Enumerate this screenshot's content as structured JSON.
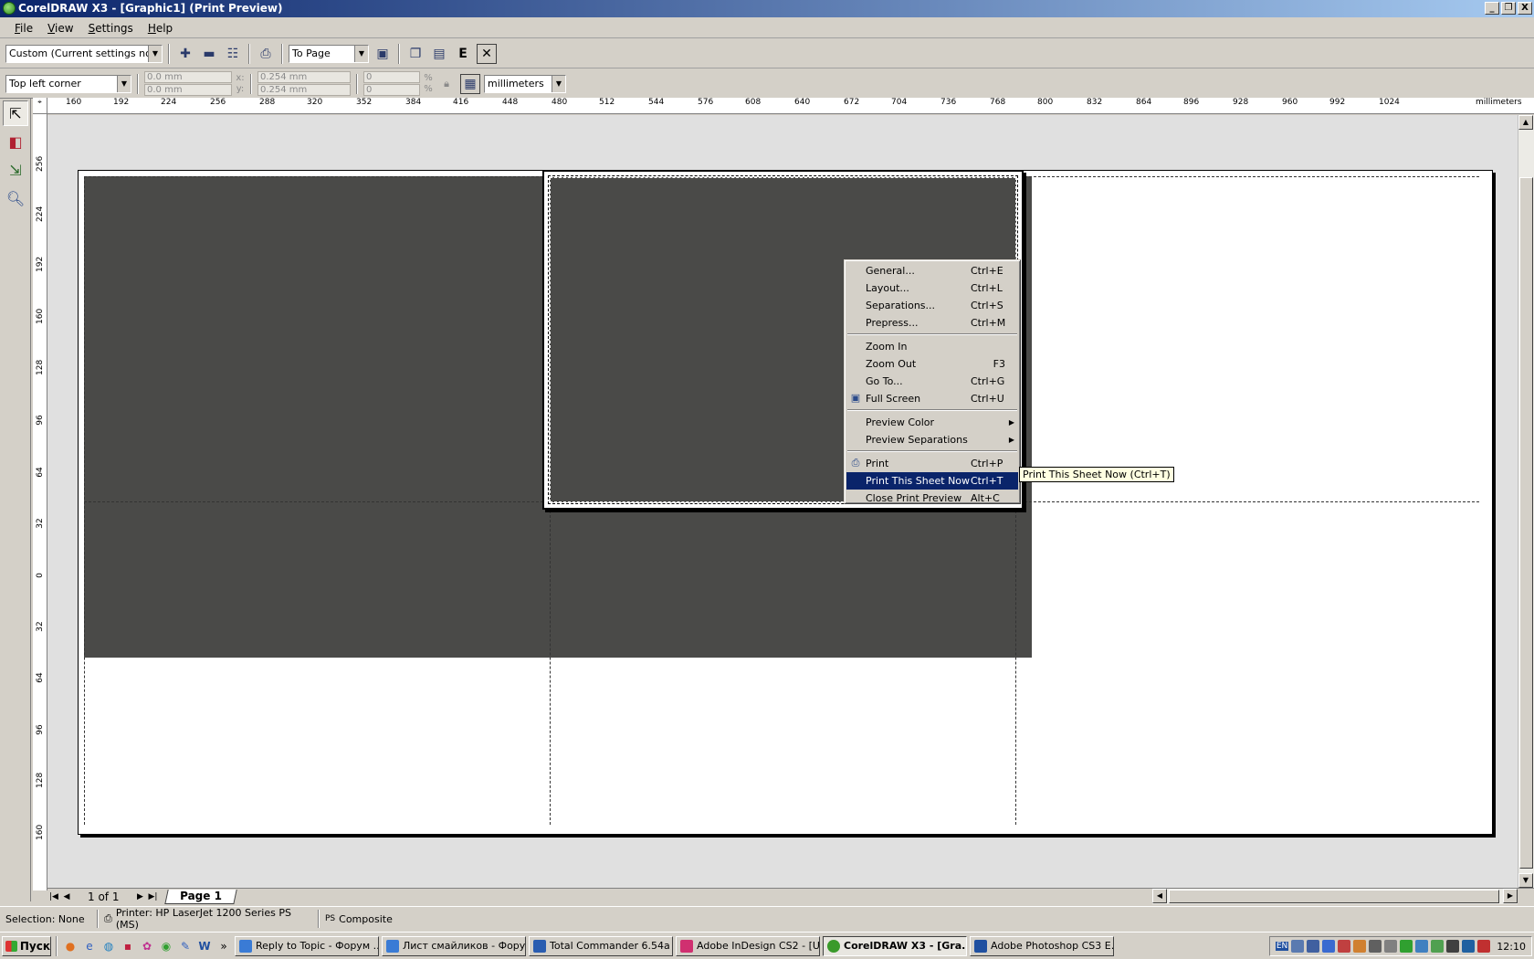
{
  "window": {
    "title": "CorelDRAW X3 - [Graphic1] (Print Preview)",
    "controls": [
      "_",
      "❐",
      "X"
    ]
  },
  "menu": [
    "File",
    "View",
    "Settings",
    "Help"
  ],
  "toolbar1": {
    "print_style": "Custom (Current settings not s...",
    "zoom": "To Page",
    "icons": [
      "zoom-in-icon",
      "zoom-out-icon",
      "print-options-icon",
      "print-icon",
      "full-screen-icon",
      "print-this-sheet-icon",
      "separations-icon",
      "enable-icon",
      "close-icon"
    ]
  },
  "toolbar2": {
    "position": "Top left corner",
    "x_value": "0.0 mm",
    "y_value": "0.0 mm",
    "x_label": "x:",
    "y_label": "y:",
    "width_value": "0.254 mm",
    "height_value": "0.254 mm",
    "scale_x": "0",
    "scale_y": "0",
    "pct_x": "%",
    "pct_y": "%",
    "units": "millimeters"
  },
  "ruler_top": [
    "160",
    "192",
    "224",
    "256",
    "288",
    "320",
    "352",
    "384",
    "416",
    "448",
    "480",
    "512",
    "544",
    "576",
    "608",
    "640",
    "672",
    "704",
    "736",
    "768",
    "800",
    "832",
    "864",
    "896",
    "928",
    "960",
    "992",
    "1024"
  ],
  "ruler_units": "millimeters",
  "ruler_left": [
    "256",
    "224",
    "192",
    "160",
    "128",
    "96",
    "64",
    "32",
    "0",
    "32",
    "64",
    "96",
    "128",
    "160"
  ],
  "context_menu": [
    {
      "label": "General...",
      "shortcut": "Ctrl+E"
    },
    {
      "label": "Layout...",
      "shortcut": "Ctrl+L"
    },
    {
      "label": "Separations...",
      "shortcut": "Ctrl+S"
    },
    {
      "label": "Prepress...",
      "shortcut": "Ctrl+M"
    },
    {
      "label": "Zoom In",
      "shortcut": ""
    },
    {
      "label": "Zoom Out",
      "shortcut": "F3"
    },
    {
      "label": "Go To...",
      "shortcut": "Ctrl+G"
    },
    {
      "label": "Full Screen",
      "shortcut": "Ctrl+U"
    },
    {
      "label": "Preview Color",
      "shortcut": ""
    },
    {
      "label": "Preview Separations",
      "shortcut": ""
    },
    {
      "label": "Print",
      "shortcut": "Ctrl+P"
    },
    {
      "label": "Print This Sheet Now",
      "shortcut": "Ctrl+T"
    },
    {
      "label": "Close Print Preview",
      "shortcut": "Alt+C"
    }
  ],
  "tooltip": "Print This Sheet Now (Ctrl+T)",
  "pagebar": {
    "count": "1 of 1",
    "tab": "Page 1"
  },
  "status": {
    "selection": "Selection: None",
    "printer": "Printer: HP LaserJet 1200 Series PS (MS)",
    "ps_label": "PS",
    "mode": "Composite"
  },
  "taskbar": {
    "start": "Пуск",
    "more": "»",
    "tasks": [
      {
        "label": "Reply to Topic - Форум ...",
        "color": "#3a7bd5"
      },
      {
        "label": "Лист смайликов - Фору...",
        "color": "#3a7bd5"
      },
      {
        "label": "Total Commander 6.54a ...",
        "color": "#2a5db0"
      },
      {
        "label": "Adobe InDesign CS2 - [U...",
        "color": "#d03070"
      },
      {
        "label": "CorelDRAW X3 - [Gra...",
        "color": "#3a9a2a"
      },
      {
        "label": "Adobe Photoshop CS3 E...",
        "color": "#2050a0"
      }
    ],
    "lang": "EN",
    "clock": "12:10"
  },
  "colors": {
    "title_start": "#0a246a",
    "title_end": "#a6caf0",
    "highlight": "#0a246a",
    "dark_fill": "#4a4a48",
    "tooltip_bg": "#ffffe1"
  }
}
